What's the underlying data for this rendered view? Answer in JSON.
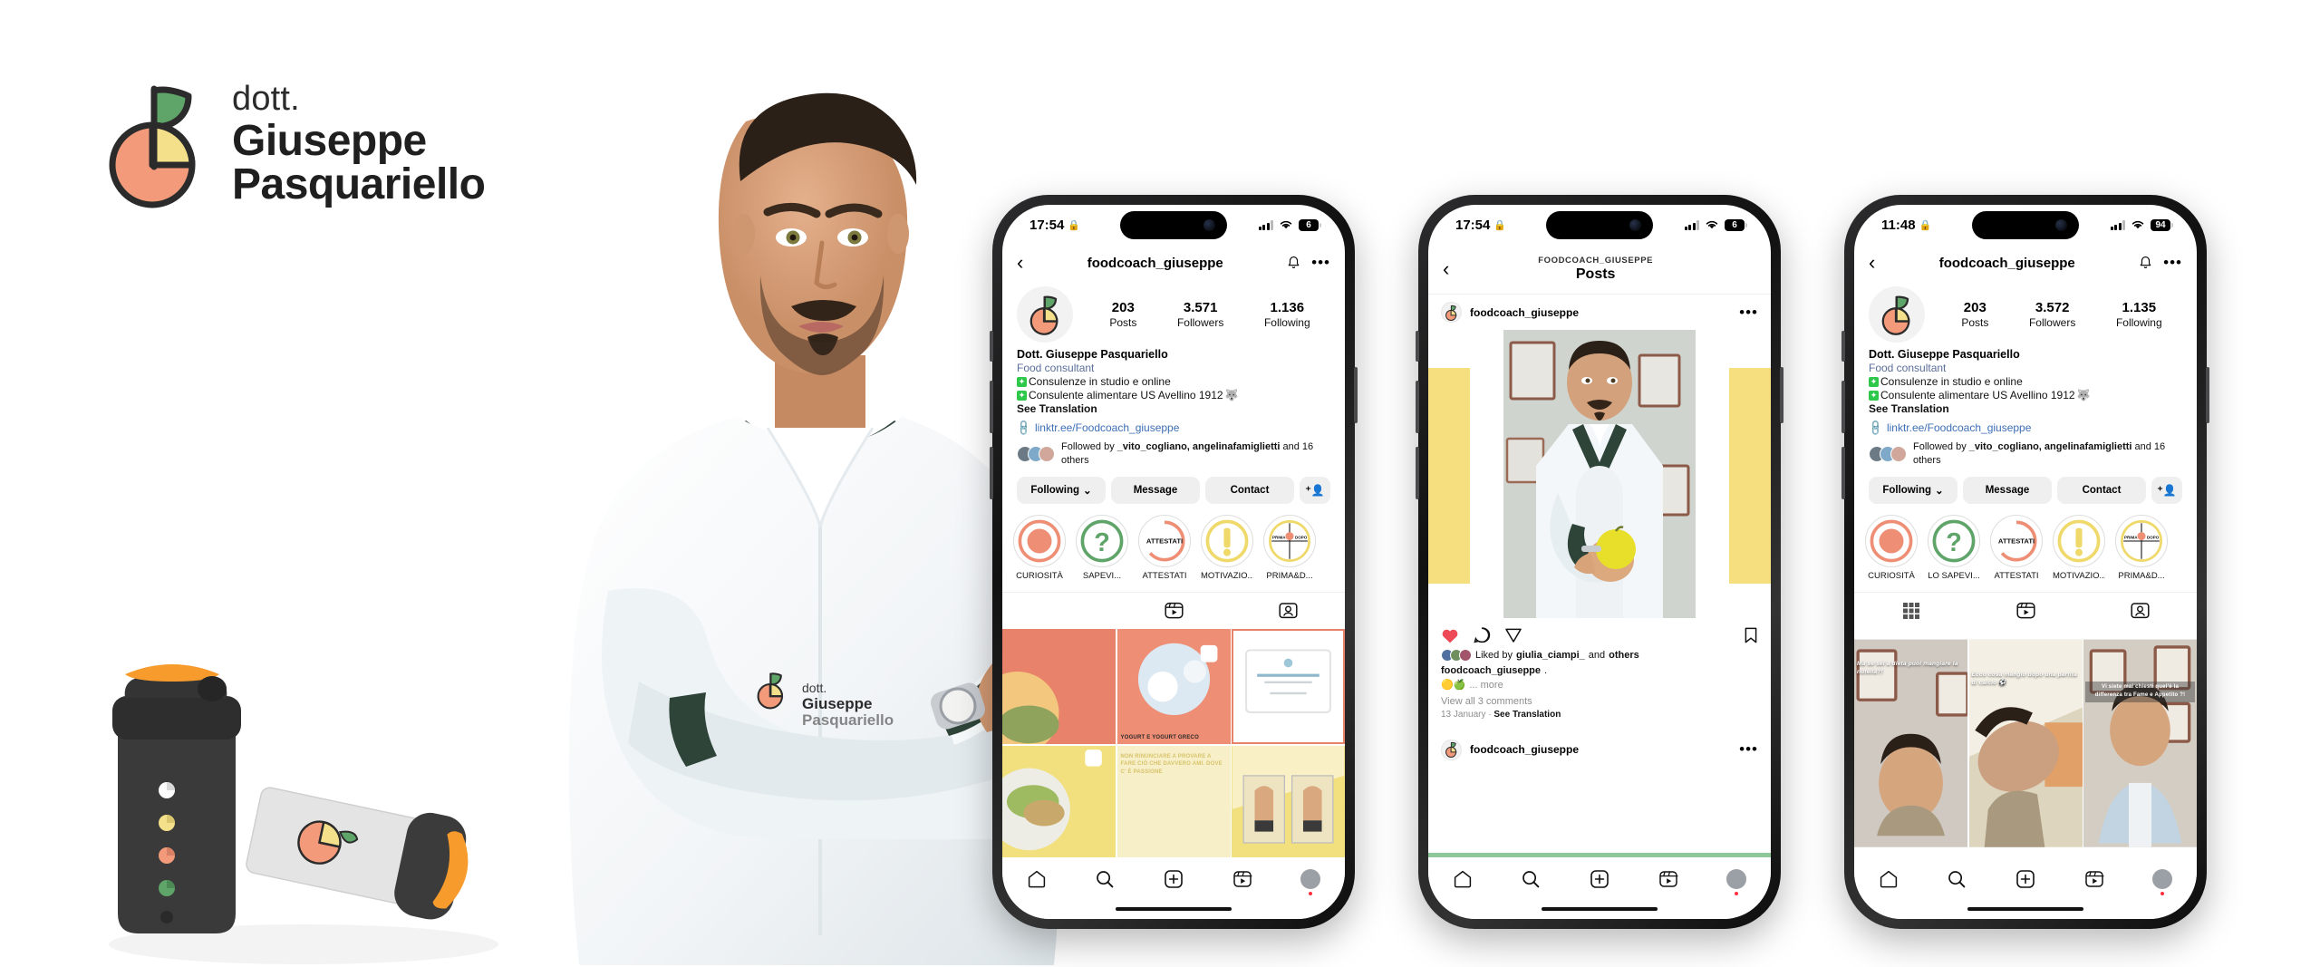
{
  "brand": {
    "prefix": "dott.",
    "first_name": "Giuseppe",
    "last_name": "Pasquariello",
    "logo_icon": "peach-pie-chart-logo",
    "colors": {
      "peach": "#F29A7A",
      "yellow": "#F4E08A",
      "green": "#5FA469",
      "outline": "#2B2B2B"
    }
  },
  "doctor_photo": {
    "name": "doctor-portrait",
    "alt": "Dott. Giuseppe Pasquariello in white lab coat, arms crossed"
  },
  "products": {
    "shaker_dark": {
      "name": "dark-shaker-bottle",
      "cap_color": "#F79B2C",
      "body_color": "#3A3A3A"
    },
    "shaker_light": {
      "name": "light-shaker-bottle",
      "cap_color": "#F79B2C",
      "body_color": "#E2E2E2"
    }
  },
  "phones": [
    {
      "id": "phone-profile-left",
      "status": {
        "time": "17:54",
        "lock_icon": "lock-icon",
        "signal_icon": "cellular-icon",
        "wifi_icon": "wifi-icon",
        "battery": "6"
      },
      "header": {
        "back_icon": "chevron-left-icon",
        "title": "foodcoach_giuseppe",
        "bell_icon": "bell-icon",
        "more_icon": "more-dots-icon"
      },
      "profile": {
        "avatar_icon": "peach-pie-chart-logo",
        "stats": [
          {
            "value": "203",
            "label": "Posts"
          },
          {
            "value": "3.571",
            "label": "Followers"
          },
          {
            "value": "1.136",
            "label": "Following"
          }
        ],
        "display_name": "Dott. Giuseppe Pasquariello",
        "category": "Food consultant",
        "bio_lines": [
          "Consulenze in studio e online",
          "Consulente alimentare US Avellino 1912"
        ],
        "see_translation": "See Translation",
        "link": "linktr.ee/Foodcoach_giuseppe",
        "link_icon": "link-chain-icon",
        "followed_by_prefix": "Followed by ",
        "followed_by_names": "_vito_cogliano, angelinafamiglietti",
        "followed_by_suffix": " and 16 others"
      },
      "actions": {
        "following": "Following",
        "chevron_icon": "chevron-down-icon",
        "message": "Message",
        "contact": "Contact",
        "add_person_icon": "add-person-icon"
      },
      "highlights": [
        {
          "label": "CURIOSITÀ",
          "icon": "speech-bubble-highlight"
        },
        {
          "label": "SAPEVI...",
          "icon": "question-mark-highlight"
        },
        {
          "label": "ATTESTATI",
          "icon": "attestati-highlight",
          "inner_text": "ATTESTATI"
        },
        {
          "label": "MOTIVAZIO...",
          "icon": "exclamation-highlight"
        },
        {
          "label": "PRIMA&D...",
          "icon": "prima-dopo-highlight",
          "inner_text": "PRIMA  DOPO"
        }
      ],
      "tabs": [
        {
          "name": "grid-tab",
          "icon": "grid-icon",
          "active": false
        },
        {
          "name": "reels-tab",
          "icon": "reels-icon",
          "active": false
        },
        {
          "name": "tagged-tab",
          "icon": "tagged-person-icon",
          "active": false
        }
      ],
      "grid": [
        {
          "caption": "",
          "bg": "#E8826A"
        },
        {
          "caption": "YOGURT E YOGURT GRECO",
          "bg": "#EE8E74",
          "cap_color": "#2b2b2b"
        },
        {
          "caption": "",
          "bg": "#ffffff",
          "border": "#E8826A"
        },
        {
          "caption": "",
          "bg": "#F2E07E"
        },
        {
          "caption": "NON RINUNCIARE A PROVARE A FARE CIÒ CHE DAVVERO  AMI. DOVE C' È PASSIONE",
          "bg": "#F6EFC8",
          "cap_color": "#D9C36A"
        },
        {
          "caption": "",
          "bg": "#F2E07E"
        }
      ],
      "bottom_nav": [
        {
          "name": "nav-home",
          "icon": "home-icon"
        },
        {
          "name": "nav-search",
          "icon": "search-icon"
        },
        {
          "name": "nav-create",
          "icon": "plus-square-icon"
        },
        {
          "name": "nav-reels",
          "icon": "reels-icon"
        },
        {
          "name": "nav-profile",
          "icon": "profile-avatar-icon"
        }
      ]
    },
    {
      "id": "phone-post-middle",
      "status": {
        "time": "17:54",
        "lock_icon": "lock-icon",
        "signal_icon": "cellular-icon",
        "wifi_icon": "wifi-icon",
        "battery": "6"
      },
      "header": {
        "back_icon": "chevron-left-icon",
        "kicker": "FOODCOACH_GIUSEPPE",
        "title": "Posts"
      },
      "post": {
        "username": "foodcoach_giuseppe",
        "avatar_icon": "peach-pie-chart-logo",
        "more_icon": "more-dots-icon",
        "media_alt": "Doctor holding a yellow apple",
        "actions": {
          "like_icon": "heart-filled-icon",
          "comment_icon": "comment-bubble-icon",
          "share_icon": "share-paperplane-icon",
          "save_icon": "bookmark-icon"
        },
        "liked_by_prefix": "Liked by ",
        "liked_by_name": "giulia_ciampi_",
        "liked_by_suffix": " and ",
        "liked_by_others": "others",
        "caption_user": "foodcoach_giuseppe",
        "caption_text": ".",
        "caption_emoji": "🟡🍏",
        "more_label": "... more",
        "view_comments": "View all 3 comments",
        "date": "13 January",
        "separator": "·",
        "see_translation": "See Translation",
        "next_post_username": "foodcoach_giuseppe",
        "next_post_more_icon": "more-dots-icon"
      },
      "bottom_nav": [
        {
          "name": "nav-home",
          "icon": "home-icon"
        },
        {
          "name": "nav-search",
          "icon": "search-icon"
        },
        {
          "name": "nav-create",
          "icon": "plus-square-icon"
        },
        {
          "name": "nav-reels",
          "icon": "reels-icon"
        },
        {
          "name": "nav-profile",
          "icon": "profile-avatar-icon"
        }
      ]
    },
    {
      "id": "phone-profile-right",
      "status": {
        "time": "11:48",
        "lock_icon": "lock-icon",
        "signal_icon": "cellular-icon",
        "wifi_icon": "wifi-icon",
        "battery": "94"
      },
      "header": {
        "back_icon": "chevron-left-icon",
        "title": "foodcoach_giuseppe",
        "bell_icon": "bell-icon",
        "more_icon": "more-dots-icon"
      },
      "profile": {
        "avatar_icon": "peach-pie-chart-logo",
        "stats": [
          {
            "value": "203",
            "label": "Posts"
          },
          {
            "value": "3.572",
            "label": "Followers"
          },
          {
            "value": "1.135",
            "label": "Following"
          }
        ],
        "display_name": "Dott. Giuseppe Pasquariello",
        "category": "Food consultant",
        "bio_lines": [
          "Consulenze in studio e online",
          "Consulente alimentare US Avellino 1912"
        ],
        "see_translation": "See Translation",
        "link": "linktr.ee/Foodcoach_giuseppe",
        "link_icon": "link-chain-icon",
        "followed_by_prefix": "Followed by ",
        "followed_by_names": "_vito_cogliano, angelinafamiglietti",
        "followed_by_suffix": " and 16 others"
      },
      "actions": {
        "following": "Following",
        "chevron_icon": "chevron-down-icon",
        "message": "Message",
        "contact": "Contact",
        "add_person_icon": "add-person-icon"
      },
      "highlights": [
        {
          "label": "CURIOSITÀ",
          "icon": "speech-bubble-highlight"
        },
        {
          "label": "LO SAPEVI...",
          "icon": "question-mark-highlight"
        },
        {
          "label": "ATTESTATI",
          "icon": "attestati-highlight",
          "inner_text": "ATTESTATI"
        },
        {
          "label": "MOTIVAZIO...",
          "icon": "exclamation-highlight"
        },
        {
          "label": "PRIMA&D...",
          "icon": "prima-dopo-highlight",
          "inner_text": "PRIMA  DOPO"
        }
      ],
      "tabs": [
        {
          "name": "grid-tab",
          "icon": "grid-icon",
          "active": true
        },
        {
          "name": "reels-tab",
          "icon": "reels-icon",
          "active": false
        },
        {
          "name": "tagged-tab",
          "icon": "tagged-person-icon",
          "active": false
        }
      ],
      "reels": [
        {
          "overlay": "Ma se sei a dieta puoi mangiare la nutella?!"
        },
        {
          "overlay": "Ecco cosa mangio dopo una partita di calcio ⚽"
        },
        {
          "overlay": "Vi siete mai chiesti quel'è la differenza tra Fame e Appetito ?!"
        }
      ],
      "bottom_nav": [
        {
          "name": "nav-home",
          "icon": "home-icon"
        },
        {
          "name": "nav-search",
          "icon": "search-icon"
        },
        {
          "name": "nav-create",
          "icon": "plus-square-icon"
        },
        {
          "name": "nav-reels",
          "icon": "reels-icon"
        },
        {
          "name": "nav-profile",
          "icon": "profile-avatar-icon"
        }
      ]
    }
  ]
}
